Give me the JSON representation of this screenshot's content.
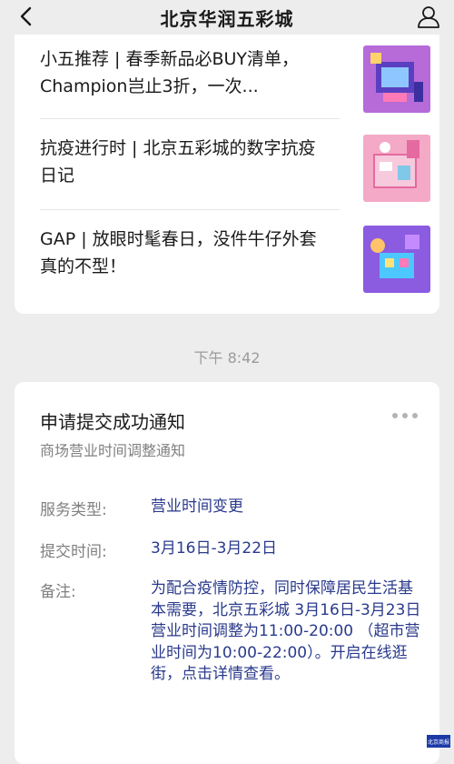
{
  "header": {
    "title": "北京华润五彩城"
  },
  "articles": [
    {
      "title": "小五推荐 | 春季新品必BUY清单，Champion岂止3折，一次..."
    },
    {
      "title": "抗疫进行时 | 北京五彩城的数字抗疫日记"
    },
    {
      "title": "GAP | 放眼时髦春日，没件牛仔外套真的不型！"
    }
  ],
  "timestamp": "下午 8:42",
  "notice": {
    "title": "申请提交成功通知",
    "subtitle": "商场营业时间调整通知",
    "rows": [
      {
        "label": "服务类型:",
        "value": "营业时间变更"
      },
      {
        "label": "提交时间:",
        "value": "3月16日-3月22日"
      },
      {
        "label": "备注:",
        "value": "为配合疫情防控，同时保障居民生活基本需要，北京五彩城 3月16日-3月23日营业时间调整为11:00-20:00 （超市营业时间为10:00-22:00）。开启在线逛街，点击详情查看。"
      }
    ]
  },
  "watermark": "北京商报",
  "colors": {
    "background": "#ededed",
    "card": "#ffffff",
    "value_text": "#2a3a8c",
    "muted_text": "#808080"
  },
  "icons": {
    "back": "chevron-left-icon",
    "profile": "user-icon",
    "more": "more-dots-icon"
  }
}
